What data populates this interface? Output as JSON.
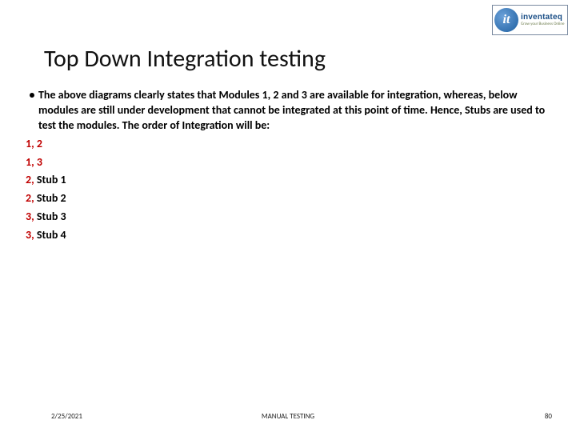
{
  "logo": {
    "glyph": "it",
    "main": "inventateq",
    "sub": "Grow your Business Online"
  },
  "title": "Top Down Integration testing",
  "body": {
    "bullet": "The above diagrams clearly states that Modules 1, 2 and 3 are available for integration, whereas, below modules are still under development that cannot be integrated at this point of time. Hence, Stubs are used to test the modules. The order of Integration will be:",
    "order": [
      {
        "num": "1, 2",
        "stub": ""
      },
      {
        "num": "1, 3",
        "stub": ""
      },
      {
        "num": "2, ",
        "stub": "Stub 1"
      },
      {
        "num": "2, ",
        "stub": "Stub 2"
      },
      {
        "num": "3, ",
        "stub": "Stub 3"
      },
      {
        "num": "3, ",
        "stub": "Stub 4"
      }
    ]
  },
  "footer": {
    "date": "2/25/2021",
    "center": "MANUAL TESTING",
    "page": "80"
  }
}
